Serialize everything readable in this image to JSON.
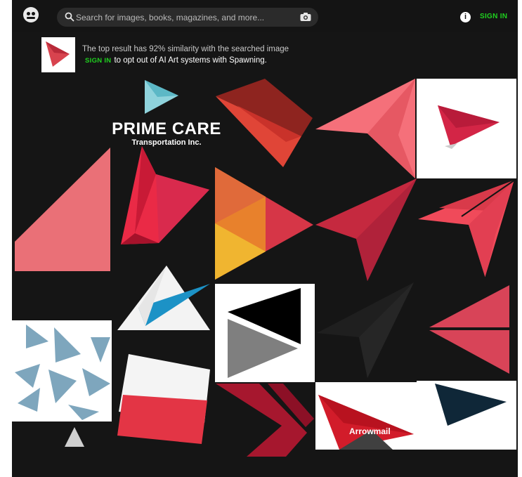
{
  "header": {
    "logo_icon": "spawning-face-icon",
    "search_placeholder": "Search for images, books, magazines, and more...",
    "search_icon": "search-icon",
    "camera_icon": "camera-icon",
    "info_icon": "info-icon",
    "info_glyph": "i",
    "signin_label": "SIGN IN",
    "accent_color": "#1fd11f"
  },
  "notice": {
    "similarity_text": "The top result has 92% similarity with the searched image",
    "signin_label": "SIGN IN",
    "optout_text": "to opt out of AI Art systems with Spawning."
  },
  "results": {
    "prime_care_title": "PRIME CARE",
    "prime_care_sub": "Transportation Inc.",
    "arrowmail_label": "Arrowmail"
  }
}
